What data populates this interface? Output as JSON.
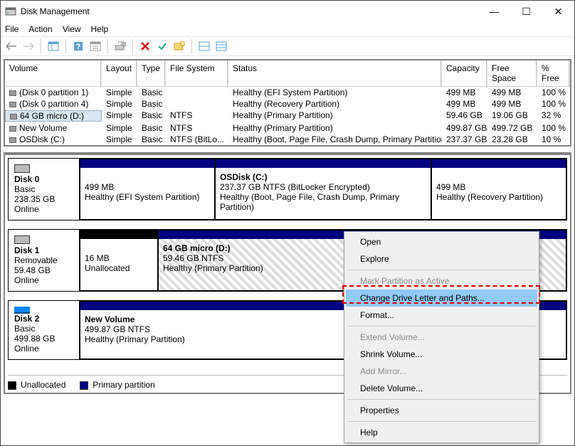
{
  "window": {
    "title": "Disk Management"
  },
  "controls": {
    "min": "—",
    "max": "☐",
    "close": "✕"
  },
  "menus": [
    "File",
    "Action",
    "View",
    "Help"
  ],
  "columns": [
    "Volume",
    "Layout",
    "Type",
    "File System",
    "Status",
    "Capacity",
    "Free Space",
    "% Free"
  ],
  "volumes": [
    {
      "name": "(Disk 0 partition 1)",
      "layout": "Simple",
      "type": "Basic",
      "fs": "",
      "status": "Healthy (EFI System Partition)",
      "cap": "499 MB",
      "free": "499 MB",
      "pct": "100 %"
    },
    {
      "name": "(Disk 0 partition 4)",
      "layout": "Simple",
      "type": "Basic",
      "fs": "",
      "status": "Healthy (Recovery Partition)",
      "cap": "499 MB",
      "free": "499 MB",
      "pct": "100 %"
    },
    {
      "name": "64 GB micro (D:)",
      "layout": "Simple",
      "type": "Basic",
      "fs": "NTFS",
      "status": "Healthy (Primary Partition)",
      "cap": "59.46 GB",
      "free": "19.06 GB",
      "pct": "32 %",
      "selected": true
    },
    {
      "name": "New Volume",
      "layout": "Simple",
      "type": "Basic",
      "fs": "NTFS",
      "status": "Healthy (Primary Partition)",
      "cap": "499.87 GB",
      "free": "499.72 GB",
      "pct": "100 %"
    },
    {
      "name": "OSDisk (C:)",
      "layout": "Simple",
      "type": "Basic",
      "fs": "NTFS (BitLo...",
      "status": "Healthy (Boot, Page File, Crash Dump, Primary Partition)",
      "cap": "237.37 GB",
      "free": "23.28 GB",
      "pct": "10 %"
    }
  ],
  "disks": {
    "d0": {
      "name": "Disk 0",
      "type": "Basic",
      "size": "238.35 GB",
      "state": "Online",
      "p0": {
        "l1": "",
        "l2": "499 MB",
        "l3": "Healthy (EFI System Partition)"
      },
      "p1": {
        "l1": "OSDisk (C:)",
        "l2": "237.37 GB NTFS (BitLocker Encrypted)",
        "l3": "Healthy (Boot, Page File, Crash Dump, Primary Partition)"
      },
      "p2": {
        "l1": "",
        "l2": "499 MB",
        "l3": "Healthy (Recovery Partition)"
      }
    },
    "d1": {
      "name": "Disk 1",
      "type": "Removable",
      "size": "59.48 GB",
      "state": "Online",
      "p0": {
        "l1": "",
        "l2": "16 MB",
        "l3": "Unallocated"
      },
      "p1": {
        "l1": "64 GB micro  (D:)",
        "l2": "59.46 GB NTFS",
        "l3": "Healthy (Primary Partition)"
      }
    },
    "d2": {
      "name": "Disk 2",
      "type": "Basic",
      "size": "499.88 GB",
      "state": "Online",
      "p0": {
        "l1": "New Volume",
        "l2": "499.87 GB NTFS",
        "l3": "Healthy (Primary Partition)"
      }
    }
  },
  "legend": {
    "unalloc": "Unallocated",
    "primary": "Primary partition"
  },
  "context_menu": [
    {
      "label": "Open",
      "enabled": true
    },
    {
      "label": "Explore",
      "enabled": true
    },
    "-",
    {
      "label": "Mark Partition as Active",
      "enabled": false
    },
    {
      "label": "Change Drive Letter and Paths...",
      "enabled": true,
      "hi": true
    },
    {
      "label": "Format...",
      "enabled": true
    },
    "-",
    {
      "label": "Extend Volume...",
      "enabled": false
    },
    {
      "label": "Shrink Volume...",
      "enabled": true
    },
    {
      "label": "Add Mirror...",
      "enabled": false
    },
    {
      "label": "Delete Volume...",
      "enabled": true
    },
    "-",
    {
      "label": "Properties",
      "enabled": true
    },
    "-",
    {
      "label": "Help",
      "enabled": true
    }
  ]
}
